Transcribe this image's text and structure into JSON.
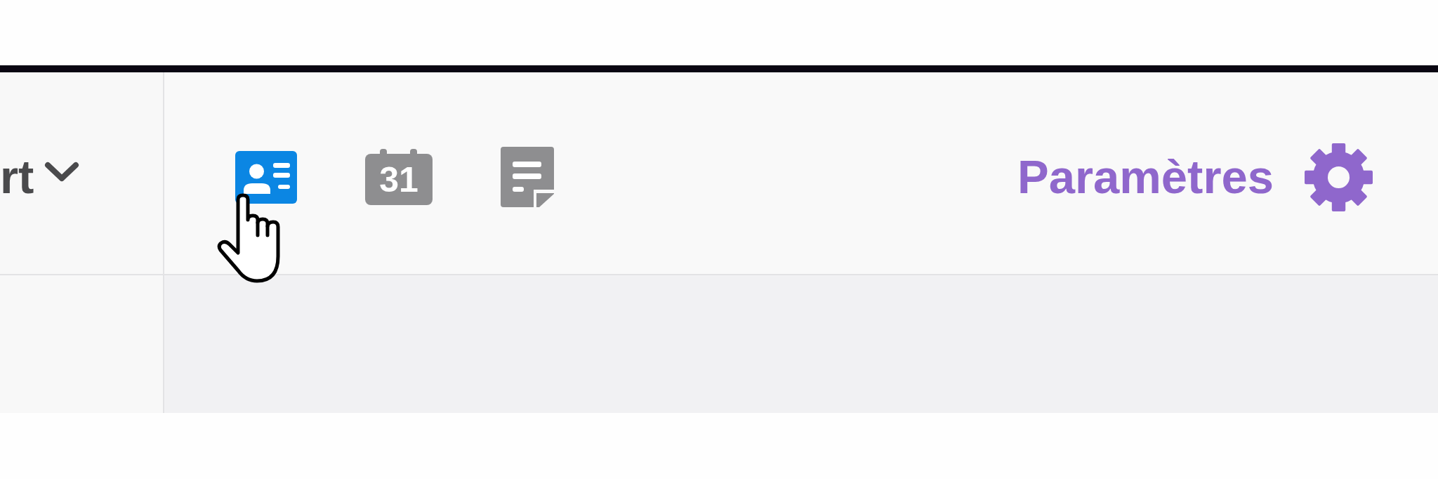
{
  "dropdown": {
    "label": "rt"
  },
  "tabs": [
    {
      "kind": "contact",
      "selected": true
    },
    {
      "kind": "calendar",
      "label": "31",
      "selected": false
    },
    {
      "kind": "notes",
      "selected": false
    }
  ],
  "settings": {
    "label": "Paramètres"
  },
  "cursor": {
    "kind": "hand"
  }
}
